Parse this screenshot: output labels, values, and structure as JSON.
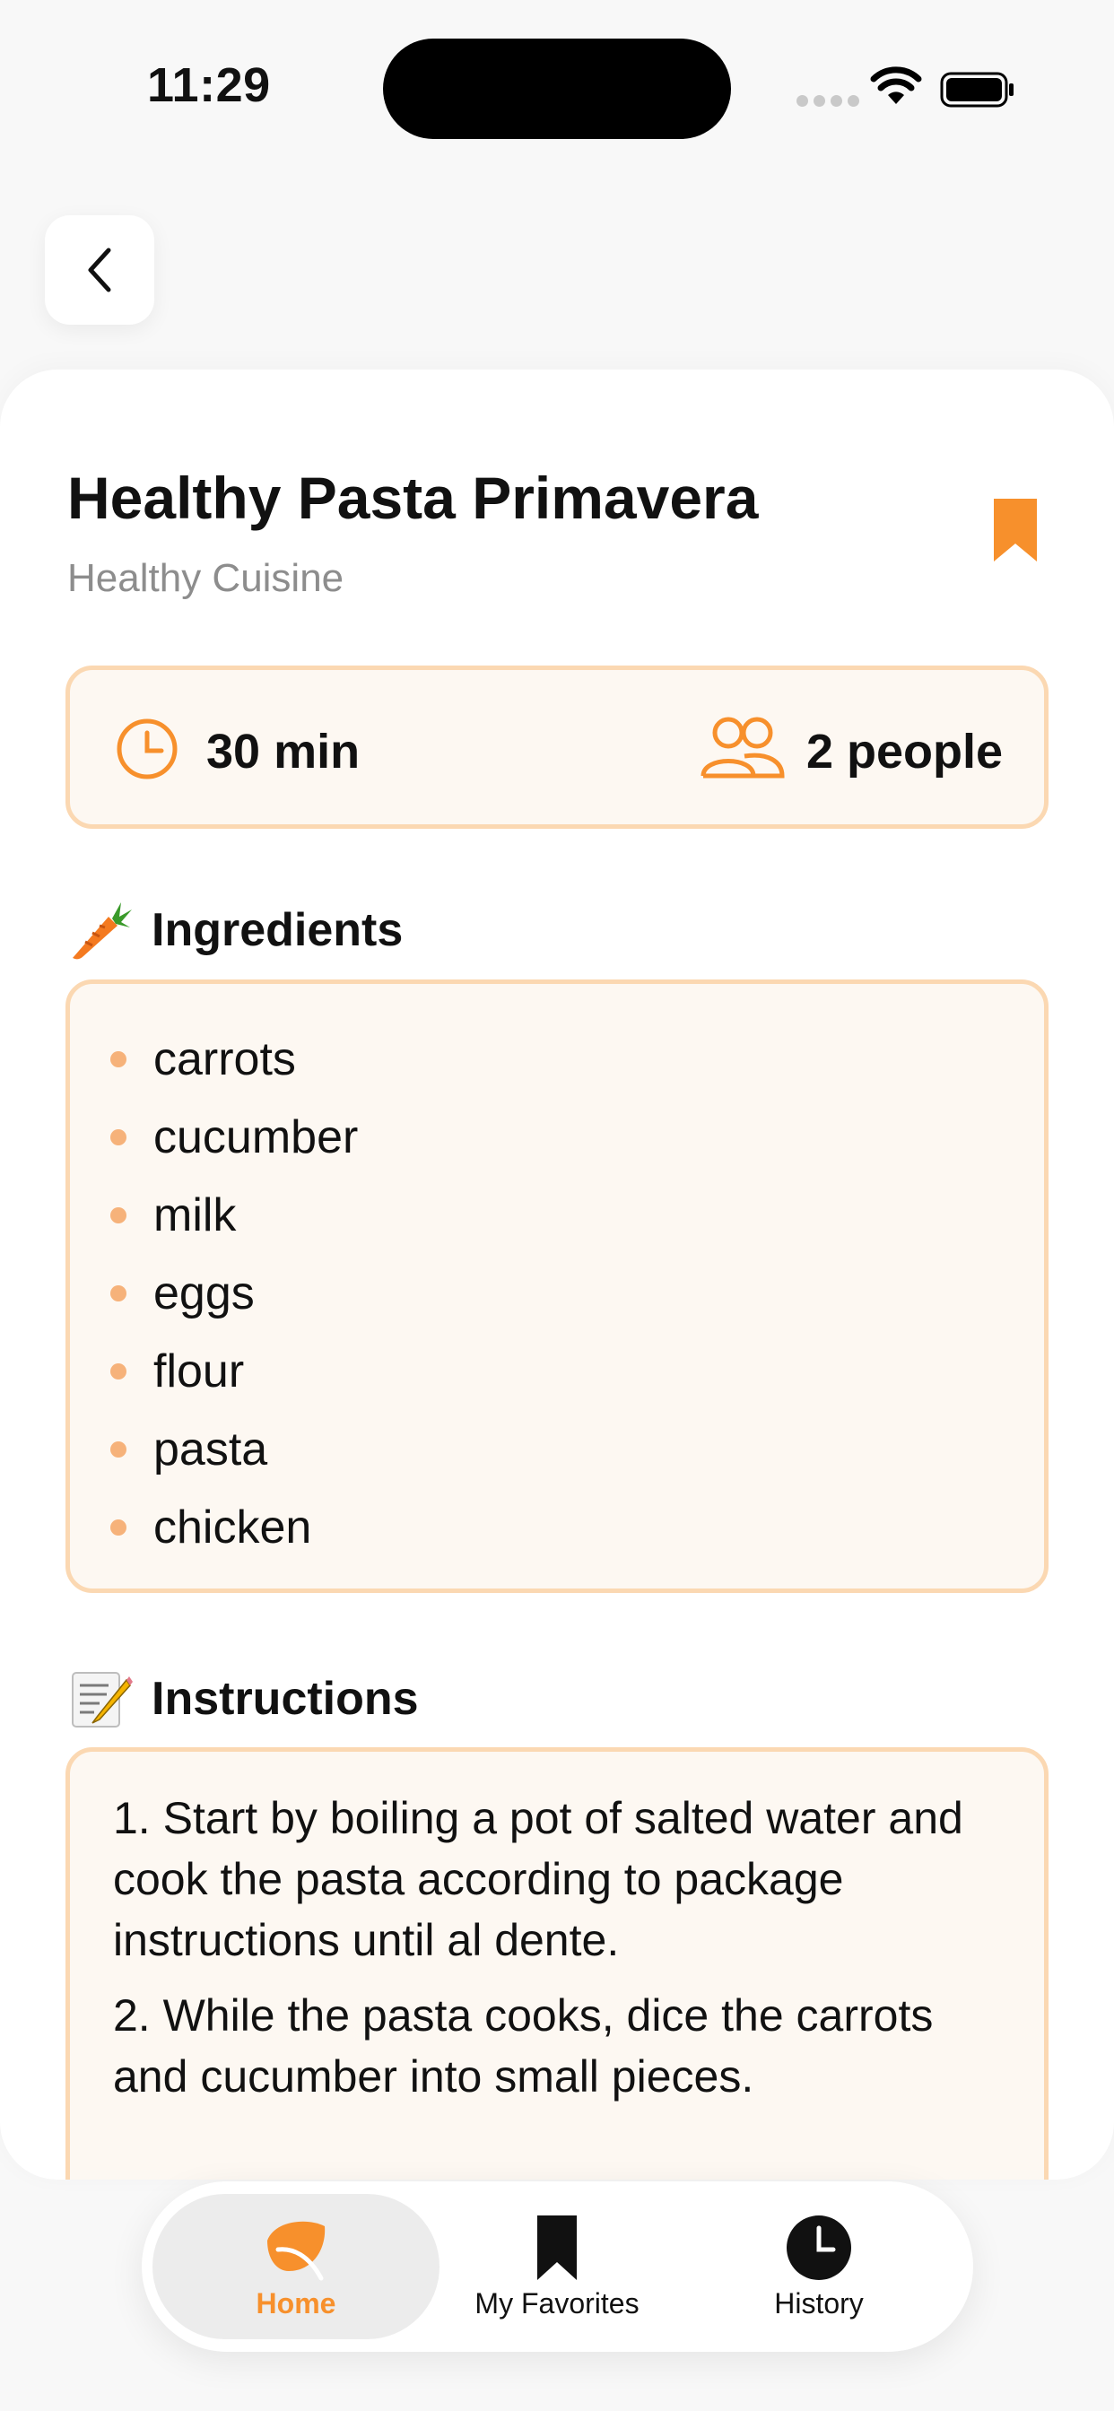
{
  "status_bar": {
    "time": "11:29"
  },
  "colors": {
    "accent": "#f7902c",
    "box_fill": "#fdf8f2",
    "box_border": "#fbd8b2",
    "bullet": "#f6b27a"
  },
  "icons": {
    "back": "chevron-left-icon",
    "bookmark": "bookmark-icon",
    "clock": "clock-icon",
    "people": "people-icon",
    "ingredients": "carrot-emoji",
    "instructions": "memo-emoji"
  },
  "recipe": {
    "title": "Healthy Pasta Primavera",
    "cuisine": "Healthy Cuisine",
    "time": "30 min",
    "servings": "2 people",
    "saved": true
  },
  "ingredients": {
    "heading": "Ingredients",
    "items": [
      "carrots",
      "cucumber",
      "milk",
      "eggs",
      "flour",
      "pasta",
      "chicken"
    ]
  },
  "instructions": {
    "heading": "Instructions",
    "steps": [
      "1. Start by boiling a pot of salted water and cook the pasta according to package instructions until al dente.",
      "2. While the pasta cooks, dice the carrots and cucumber into small pieces."
    ]
  },
  "tabs": [
    {
      "label": "Home",
      "icon": "leaf-icon",
      "active": true
    },
    {
      "label": "My Favorites",
      "icon": "bookmark-icon",
      "active": false
    },
    {
      "label": "History",
      "icon": "clock-icon",
      "active": false
    }
  ]
}
